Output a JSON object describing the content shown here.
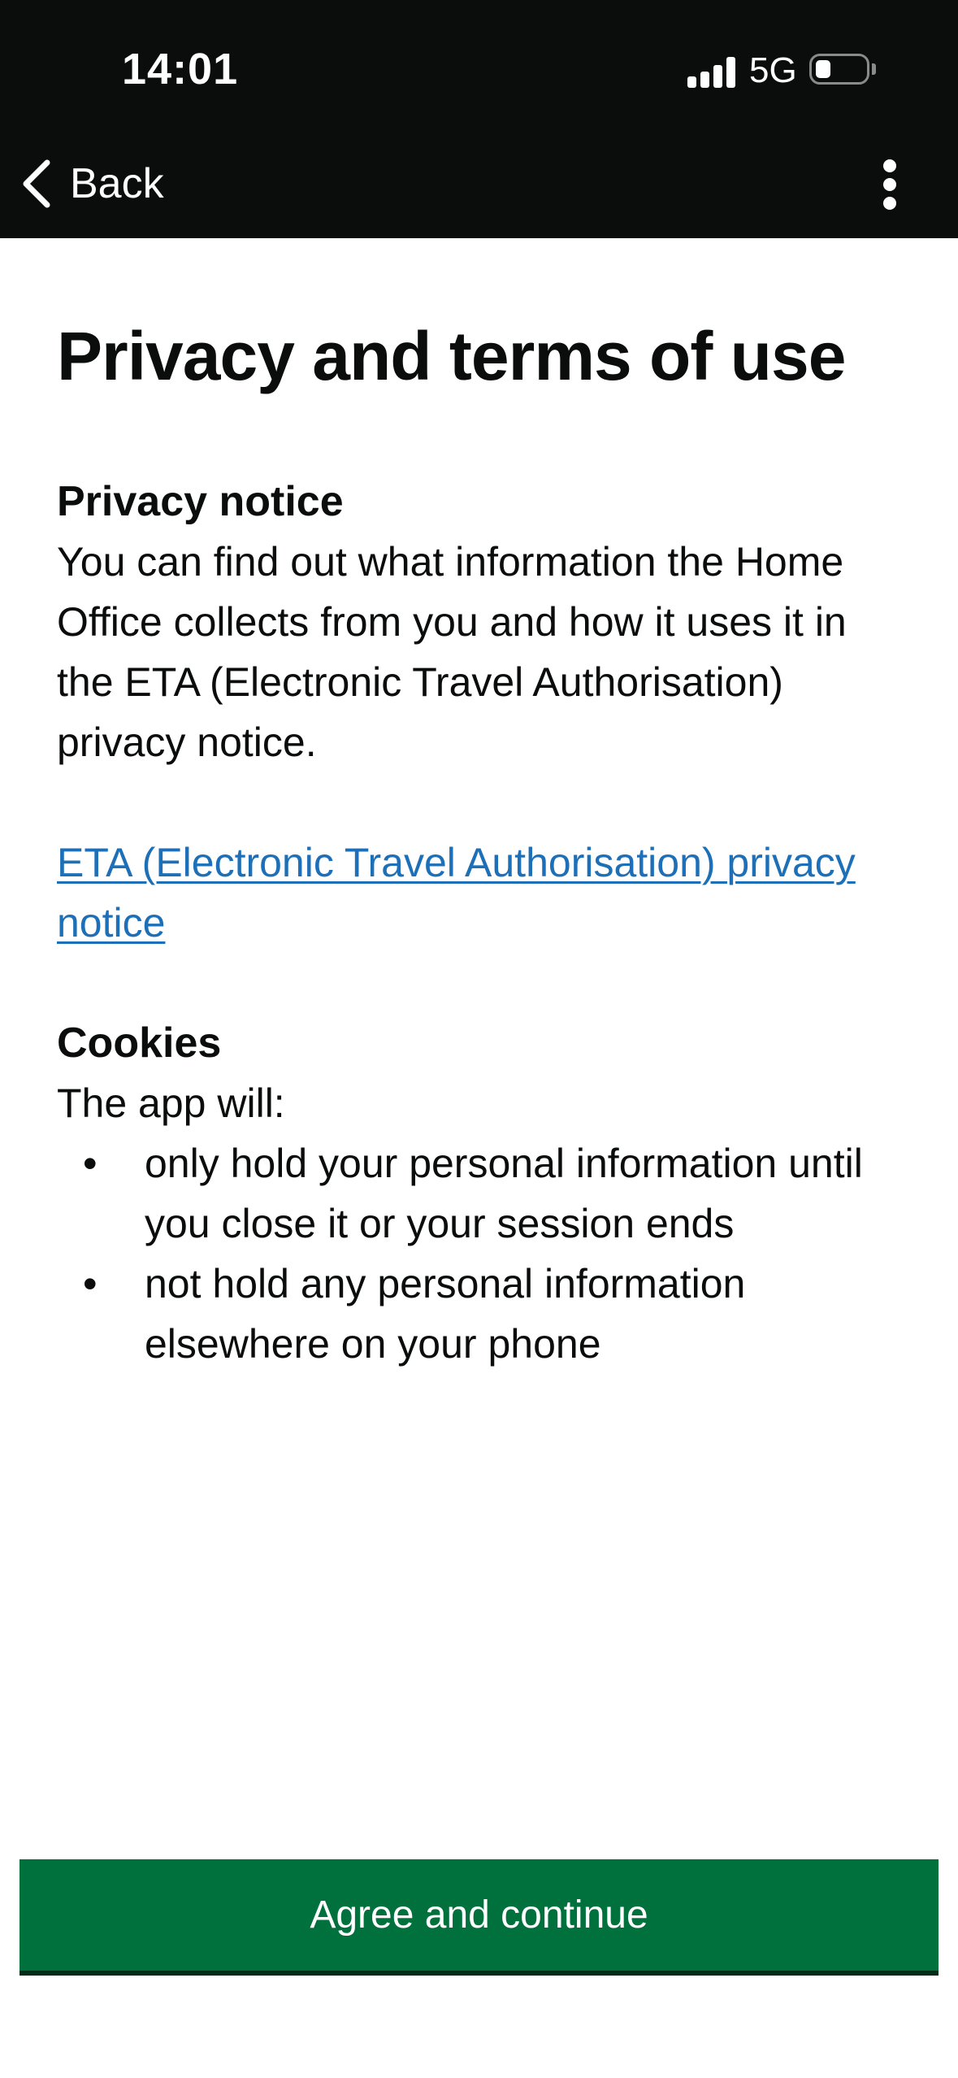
{
  "status_bar": {
    "time": "14:01",
    "network": "5G"
  },
  "header": {
    "back_label": "Back",
    "background": "#0b0c0c"
  },
  "page": {
    "title": "Privacy and terms of use",
    "privacy": {
      "heading": "Privacy notice",
      "body": "You can find out what information the Home Office collects from you and how it uses it in the ETA (Electronic Travel Authorisation) privacy notice.",
      "link_text": "ETA (Electronic Travel Authorisation) privacy notice"
    },
    "cookies": {
      "heading": "Cookies",
      "intro": "The app will:",
      "items": [
        "only hold your personal information until you close it or your session ends",
        "not hold any personal information elsewhere on your phone"
      ]
    }
  },
  "actions": {
    "primary_label": "Agree and continue"
  },
  "colors": {
    "link": "#1d70b8",
    "primary_button": "#00703c",
    "text": "#0b0c0c"
  },
  "icons": {
    "back": "chevron-left-icon",
    "menu": "more-vertical-icon",
    "signal": "cellular-signal-icon",
    "battery": "battery-icon"
  }
}
